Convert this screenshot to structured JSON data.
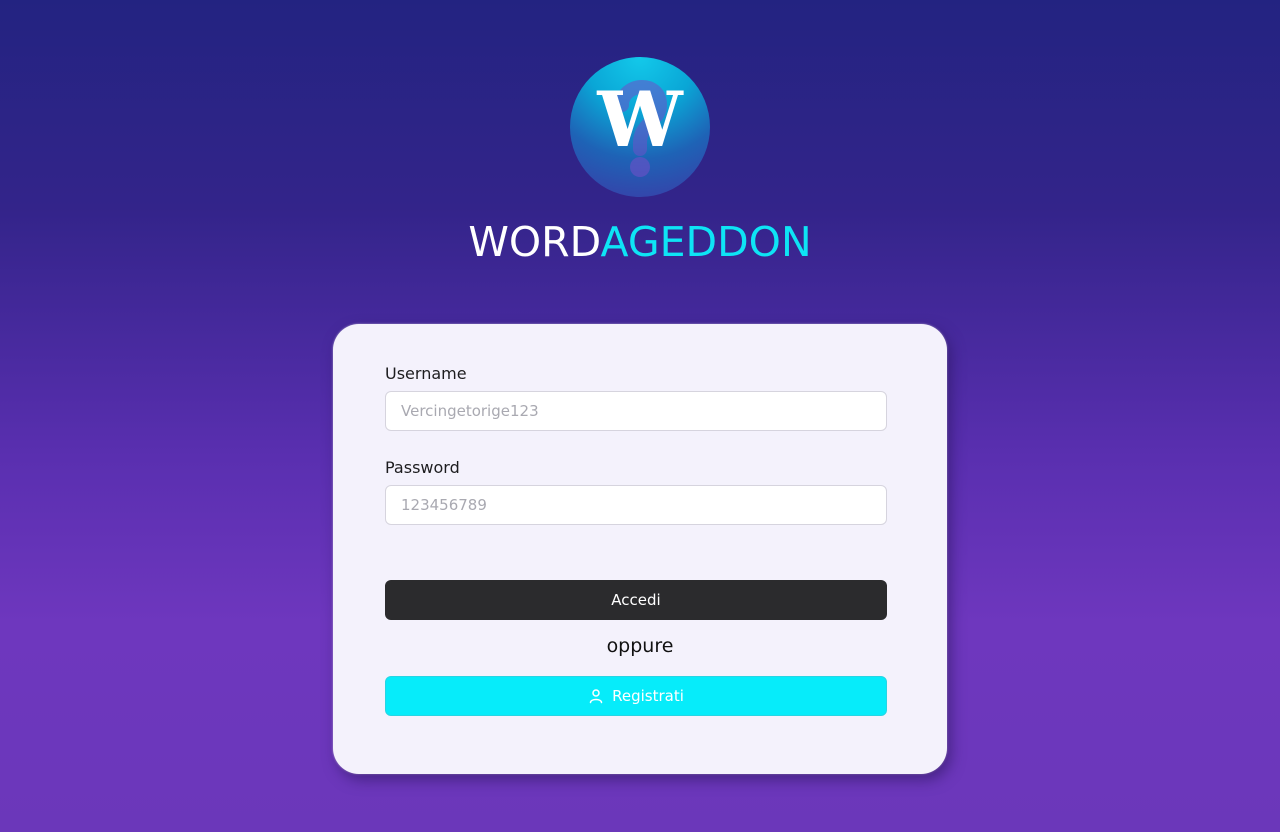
{
  "brand": {
    "logo_letter": "W",
    "name_part1": "WORD",
    "name_part2": "AGEDDON"
  },
  "form": {
    "username_label": "Username",
    "username_placeholder": "Vercingetorige123",
    "password_label": "Password",
    "password_placeholder": "123456789",
    "login_button": "Accedi",
    "separator": "oppure",
    "register_button": "Registrati",
    "register_icon": "user-icon"
  },
  "colors": {
    "accent": "#0ee4f5",
    "login_button_bg": "#2b2b2d",
    "register_button_bg": "#06ecfa"
  }
}
